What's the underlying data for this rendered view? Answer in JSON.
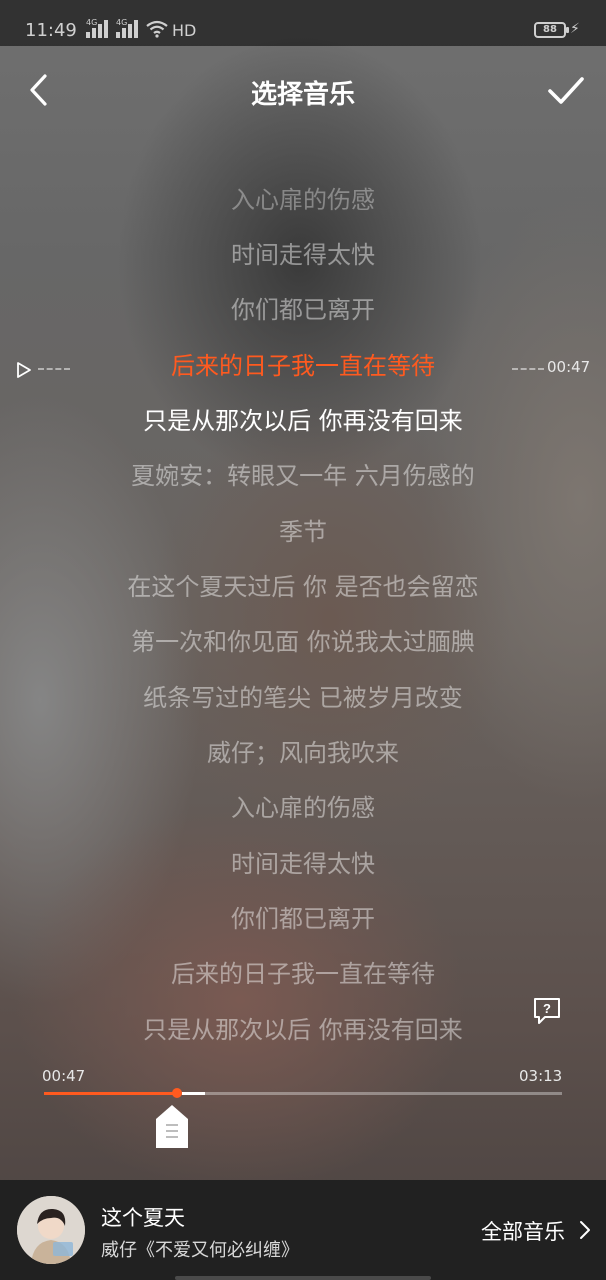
{
  "status_bar": {
    "time": "11:49",
    "network_1": "4G",
    "network_2": "4G",
    "hd": "HD",
    "battery": "88"
  },
  "header": {
    "title": "选择音乐"
  },
  "lyrics": [
    {
      "text": "入心扉的伤感",
      "state": "faded"
    },
    {
      "text": "时间走得太快",
      "state": "normal"
    },
    {
      "text": "你们都已离开",
      "state": "normal"
    },
    {
      "text": "后来的日子我一直在等待",
      "state": "active"
    },
    {
      "text": "只是从那次以后 你再没有回来",
      "state": "current"
    },
    {
      "text": "夏婉安：转眼又一年 六月伤感的",
      "state": "normal"
    },
    {
      "text": "季节",
      "state": "normal"
    },
    {
      "text": "在这个夏天过后 你 是否也会留恋",
      "state": "normal"
    },
    {
      "text": "第一次和你见面 你说我太过腼腆",
      "state": "normal"
    },
    {
      "text": "纸条写过的笔尖 已被岁月改变",
      "state": "normal"
    },
    {
      "text": "威仔；风向我吹来",
      "state": "normal"
    },
    {
      "text": "入心扉的伤感",
      "state": "normal"
    },
    {
      "text": "时间走得太快",
      "state": "normal"
    },
    {
      "text": "你们都已离开",
      "state": "normal"
    },
    {
      "text": "后来的日子我一直在等待",
      "state": "normal"
    },
    {
      "text": "只是从那次以后 你再没有回来",
      "state": "normal"
    }
  ],
  "current_line_time": "00:47",
  "progress": {
    "start_label": "00:47",
    "end_label": "03:13",
    "played_fraction": 0.257,
    "selection_end_fraction": 0.31
  },
  "colors": {
    "accent": "#ff5a1f"
  },
  "now_playing": {
    "song_title": "这个夏天",
    "subtitle": "威仔《不爱又何必纠缠》",
    "all_music_label": "全部音乐"
  }
}
